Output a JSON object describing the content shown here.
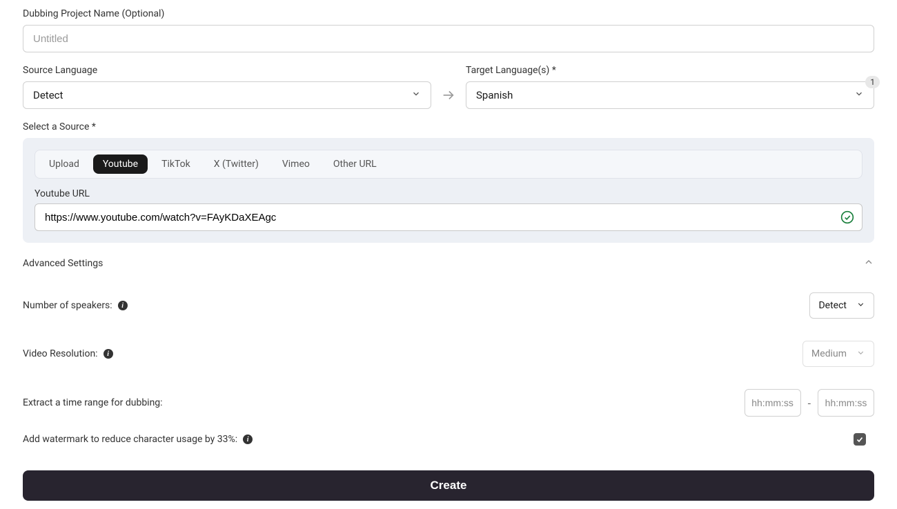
{
  "project": {
    "name_label": "Dubbing Project Name (Optional)",
    "name_placeholder": "Untitled"
  },
  "source_lang": {
    "label": "Source Language",
    "value": "Detect"
  },
  "target_lang": {
    "label": "Target Language(s) *",
    "value": "Spanish",
    "count": "1"
  },
  "source": {
    "label": "Select a Source *",
    "tabs": {
      "upload": "Upload",
      "youtube": "Youtube",
      "tiktok": "TikTok",
      "twitter": "X (Twitter)",
      "vimeo": "Vimeo",
      "other": "Other URL"
    },
    "url_label": "Youtube URL",
    "url_value": "https://www.youtube.com/watch?v=FAyKDaXEAgc"
  },
  "advanced": {
    "title": "Advanced Settings",
    "speakers_label": "Number of speakers:",
    "speakers_value": "Detect",
    "resolution_label": "Video Resolution:",
    "resolution_value": "Medium",
    "timerange_label": "Extract a time range for dubbing:",
    "time_placeholder": "hh:mm:ss",
    "dash": "-",
    "watermark_label": "Add watermark to reduce character usage by 33%:"
  },
  "create_label": "Create"
}
